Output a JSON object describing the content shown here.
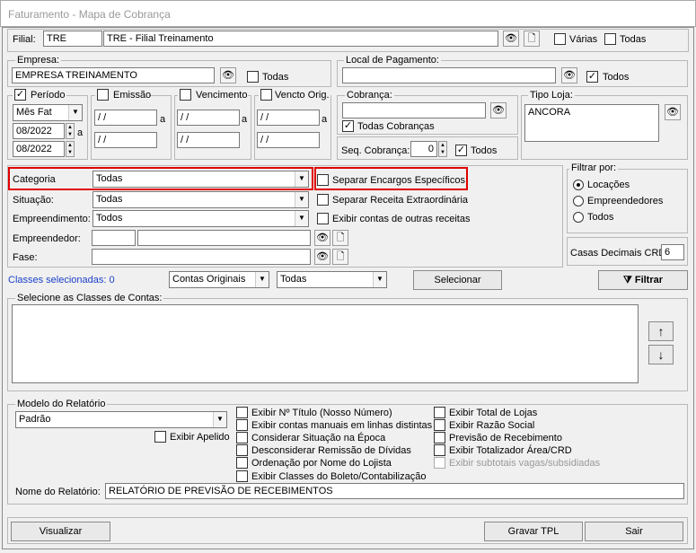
{
  "window": {
    "title": "Faturamento - Mapa de Cobrança"
  },
  "filial": {
    "label": "Filial:",
    "code": "TRE",
    "name": "TRE - Filial Treinamento",
    "varias_label": "Várias",
    "todas_label": "Todas"
  },
  "empresa": {
    "group_label": "Empresa:",
    "value": "EMPRESA TREINAMENTO",
    "todas_label": "Todas"
  },
  "local_pagamento": {
    "group_label": "Local de Pagamento:",
    "value": "",
    "todos_label": "Todos"
  },
  "periodo": {
    "label": "Período",
    "mode": "Mês Fat",
    "from": "08/2022",
    "to": "08/2022",
    "a": "a"
  },
  "emissao": {
    "label": "Emissão",
    "from": " / /",
    "to": " / /",
    "a": "a"
  },
  "vencimento": {
    "label": "Vencimento",
    "from": " / /",
    "to": " / /",
    "a": "a"
  },
  "vencto_orig": {
    "label": "Vencto Orig.",
    "from": " / /",
    "to": " / /",
    "a": "a"
  },
  "cobranca": {
    "group_label": "Cobrança:",
    "value": "",
    "todas_label": "Todas Cobranças",
    "seq_label": "Seq. Cobrança:",
    "seq_value": "0",
    "todos_label": "Todos"
  },
  "tipo_loja": {
    "group_label": "Tipo Loja:",
    "value": "ANCORA"
  },
  "filters": {
    "categoria_label": "Categoria",
    "categoria_value": "Todas",
    "situacao_label": "Situação:",
    "situacao_value": "Todas",
    "empreendimento_label": "Empreendimento:",
    "empreendimento_value": "Todos",
    "empreendedor_label": "Empreendedor:",
    "fase_label": "Fase:"
  },
  "options": {
    "separar_encargos": "Separar Encargos Específicos",
    "separar_receita": "Separar Receita Extraordinária",
    "exibir_outras": "Exibir contas de outras receitas"
  },
  "filtrar_por": {
    "label": "Filtrar por:",
    "items": [
      "Locações",
      "Empreendedores",
      "Todos"
    ]
  },
  "casas_decimais": {
    "label": "Casas Decimais CRD",
    "value": "6"
  },
  "classes": {
    "selected_label": "Classes selecionadas: 0",
    "contas_value": "Contas Originais",
    "todas_value": "Todas",
    "selecionar_label": "Selecionar",
    "filtrar_label": "Filtrar",
    "group_label": "Selecione as Classes de Contas:",
    "up_arrow": "↑",
    "down_arrow": "↓"
  },
  "modelo": {
    "group_label": "Modelo do Relatório",
    "value": "Padrão",
    "exibir_apelido": "Exibir Apelido",
    "checks_col1": [
      "Exibir Nº Título (Nosso Número)",
      "Exibir contas manuais em linhas distintas",
      "Considerar Situação na Época",
      "Desconsiderar Remissão de Dívidas",
      "Ordenação por Nome do Lojista",
      "Exibir Classes do Boleto/Contabilização"
    ],
    "checks_col2": [
      "Exibir Total de Lojas",
      "Exibir Razão Social",
      "Previsão de Recebimento",
      "Exibir Totalizador Área/CRD",
      "Exibir subtotais vagas/subsidiadas"
    ],
    "nome_label": "Nome do Relatório:",
    "nome_value": "RELATÓRIO DE PREVISÃO DE RECEBIMENTOS"
  },
  "footer": {
    "visualizar": "Visualizar",
    "gravar": "Gravar TPL",
    "sair": "Sair"
  },
  "icons": {
    "binoculars": "binoculars-icon",
    "new_doc": "new-document-icon",
    "funnel": "funnel-icon"
  },
  "colors": {
    "highlight": "#e00000",
    "link_blue": "#1a3fc8"
  }
}
